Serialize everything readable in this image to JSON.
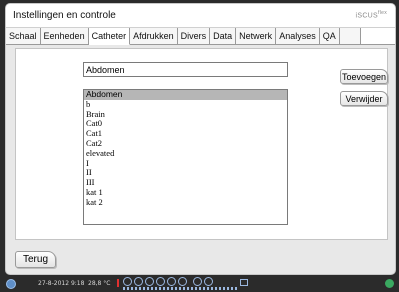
{
  "window": {
    "title": "Instellingen en controle",
    "brand": "iSCUS",
    "brand_sup": "flex"
  },
  "tabs": [
    {
      "label": "Schaal",
      "active": false
    },
    {
      "label": "Eenheden",
      "active": false
    },
    {
      "label": "Catheter",
      "active": true
    },
    {
      "label": "Afdrukken",
      "active": false
    },
    {
      "label": "Divers",
      "active": false
    },
    {
      "label": "Data",
      "active": false
    },
    {
      "label": "Netwerk",
      "active": false
    },
    {
      "label": "Analyses",
      "active": false
    },
    {
      "label": "QA",
      "active": false
    }
  ],
  "catheter": {
    "name_value": "Abdomen",
    "list": [
      "Abdomen",
      "b",
      "Brain",
      "Cat0",
      "Cat1",
      "Cat2",
      "elevated",
      "I",
      "II",
      "III",
      "kat 1",
      "kat 2"
    ],
    "selected_index": 0,
    "add_label": "Toevoegen",
    "remove_label": "Verwijder"
  },
  "footer": {
    "back_label": "Terug"
  },
  "status": {
    "datetime": "27-8-2012 9:18",
    "temperature": "28,8 °C"
  },
  "colors": {
    "selection": "#b6b6b6",
    "status_bg": "#2b2b2b"
  }
}
